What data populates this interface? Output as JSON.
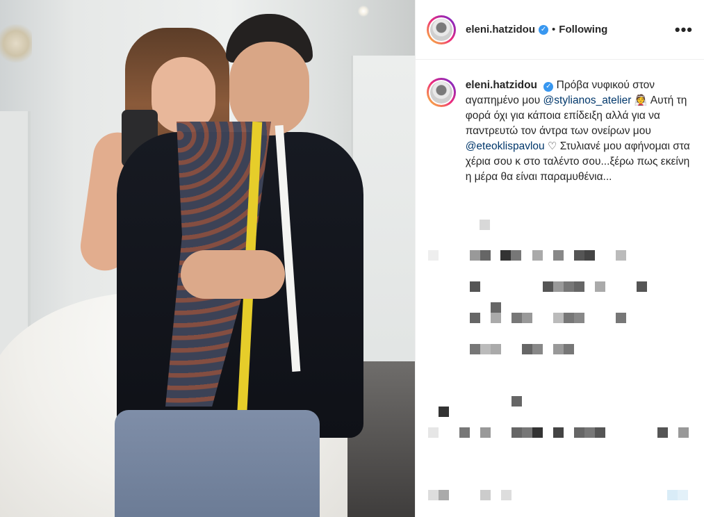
{
  "post": {
    "username": "eleni.hatzidou",
    "verified_icon": "verified-badge-icon",
    "separator": "•",
    "follow_status": "Following",
    "more_icon": "•••"
  },
  "caption": {
    "username": "eleni.hatzidou",
    "text_1": "Πρόβα νυφικού στον αγαπημένο μου",
    "mention_1": "@stylianos_atelier",
    "emoji_1": "👰",
    "text_2": "Αυτή τη φορά όχι για κάποια επίδειξη αλλά για να παντρευτώ τον άντρα των ονείρων μου",
    "mention_2": "@eteoklispavlou",
    "emoji_2": "♡",
    "text_3": "Στυλιανέ μου αφήνομαι στα χέρια σου κ στο ταλέντο σου...ξέρω πως εκείνη η μέρα θα είναι παραμυθένια..."
  },
  "colors": {
    "text": "#262626",
    "mention": "#00376b",
    "verified": "#3897f0"
  }
}
